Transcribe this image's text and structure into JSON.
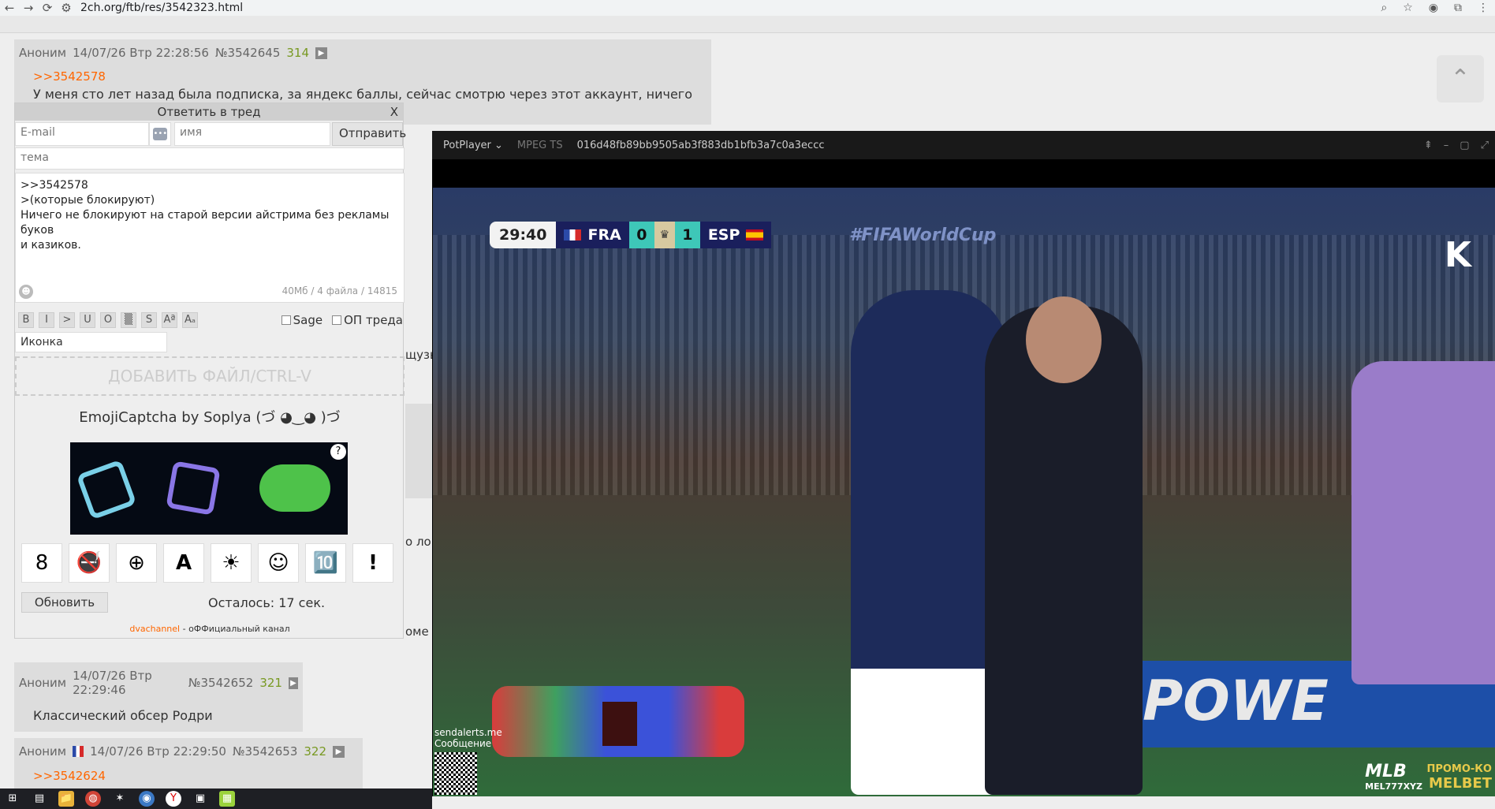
{
  "browser": {
    "url": "2ch.org/ftb/res/3542323.html",
    "back_icon": "←",
    "forward_icon": "→",
    "reload_icon": "⟳",
    "site_info_icon": "⚙",
    "zoom_icon": "⌕",
    "star_icon": "☆",
    "ext_icon": "◉",
    "puzzle_icon": "⧉",
    "menu_icon": "⋮"
  },
  "posts": [
    {
      "author": "Аноним",
      "date": "14/07/26 Втр 22:28:56",
      "number": "№3542645",
      "count": "314",
      "quote": ">>3542578",
      "text": "У меня сто лет назад была подписка, за яндекс баллы, сейчас смотрю через этот аккаунт, ничего не платил"
    },
    {
      "author": "Аноним",
      "date": "14/07/26 Втр 22:29:46",
      "number": "№3542652",
      "count": "321",
      "text": "Классический обсер Родри"
    },
    {
      "author": "Аноним",
      "date": "14/07/26 Втр 22:29:50",
      "number": "№3542653",
      "count": "322",
      "quote": ">>3542624"
    }
  ],
  "reply_form": {
    "title": "Ответить в тред",
    "close": "X",
    "email_placeholder": "E-mail",
    "name_placeholder": "имя",
    "send_label": "Отправить",
    "subject_placeholder": "тема",
    "message_lines": [
      ">>3542578",
      ">(которые блокируют)",
      "Ничего не блокируют на старой версии айстрима без рекламы буков",
      "и казиков."
    ],
    "meta": "40Мб / 4 файла / 14815",
    "format_buttons": [
      "B",
      "I",
      ">",
      "U",
      "O",
      "▒",
      "S",
      "Aª",
      "Aₐ"
    ],
    "sage_label": "Sage",
    "op_label": "ОП треда",
    "icon_select": "Иконка",
    "add_file": "ДОБАВИТЬ ФАЙЛ/CTRL-V",
    "captcha_title": "EmojiCaptcha by Soplya (づ ◕‿◕ )づ",
    "captcha_help": "?",
    "emoji_options": [
      "8",
      "🚭",
      "⊕",
      "A",
      "☀",
      "☺",
      "🔟",
      "!"
    ],
    "refresh_label": "Обновить",
    "remaining": "Осталось: 17 сек.",
    "channel_link": "dvachannel",
    "channel_text": " - оФФициальный канал"
  },
  "side_fragments": [
    "щузь",
    "о ло",
    "оме"
  ],
  "scroll_top_icon": "⌃",
  "player": {
    "app": "PotPlayer ⌄",
    "format": "MPEG TS",
    "file": "016d48fb89bb9505ab3f883db1bfb3a7c0a3eccc",
    "controls": [
      "⇞",
      "–",
      "▢",
      "⤢"
    ],
    "score": {
      "time": "29:40",
      "home": "FRA",
      "home_score": "0",
      "away_score": "1",
      "away": "ESP"
    },
    "hashtag": "#FIFAWorldCup",
    "brand": "K",
    "ad_text": "POWE",
    "overlay_lines": [
      "sendalerts.me",
      "Сообщение"
    ],
    "mlb": "MLB",
    "mlb_sub": "MEL777XYZ",
    "promo": "ПРОМО-КО",
    "promo_brand": "MELBET"
  },
  "taskbar": [
    "⊞",
    "▤",
    "📁",
    "◍",
    "✶",
    "◉",
    "Y",
    "▣",
    "▦"
  ]
}
